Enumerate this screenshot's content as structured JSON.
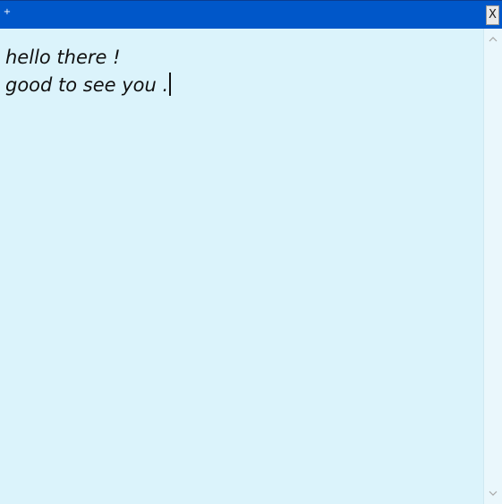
{
  "titlebar": {
    "new_label": "+",
    "close_label": "X",
    "colors": {
      "background": "#0057c9",
      "close_bg": "#e9e9e9"
    }
  },
  "editor": {
    "lines": [
      "hello there !",
      "good to see you ."
    ],
    "colors": {
      "background": "#dbf3fb",
      "text": "#111111"
    }
  },
  "scrollbar": {
    "up_icon": "chevron-up-icon",
    "down_icon": "chevron-down-icon"
  }
}
